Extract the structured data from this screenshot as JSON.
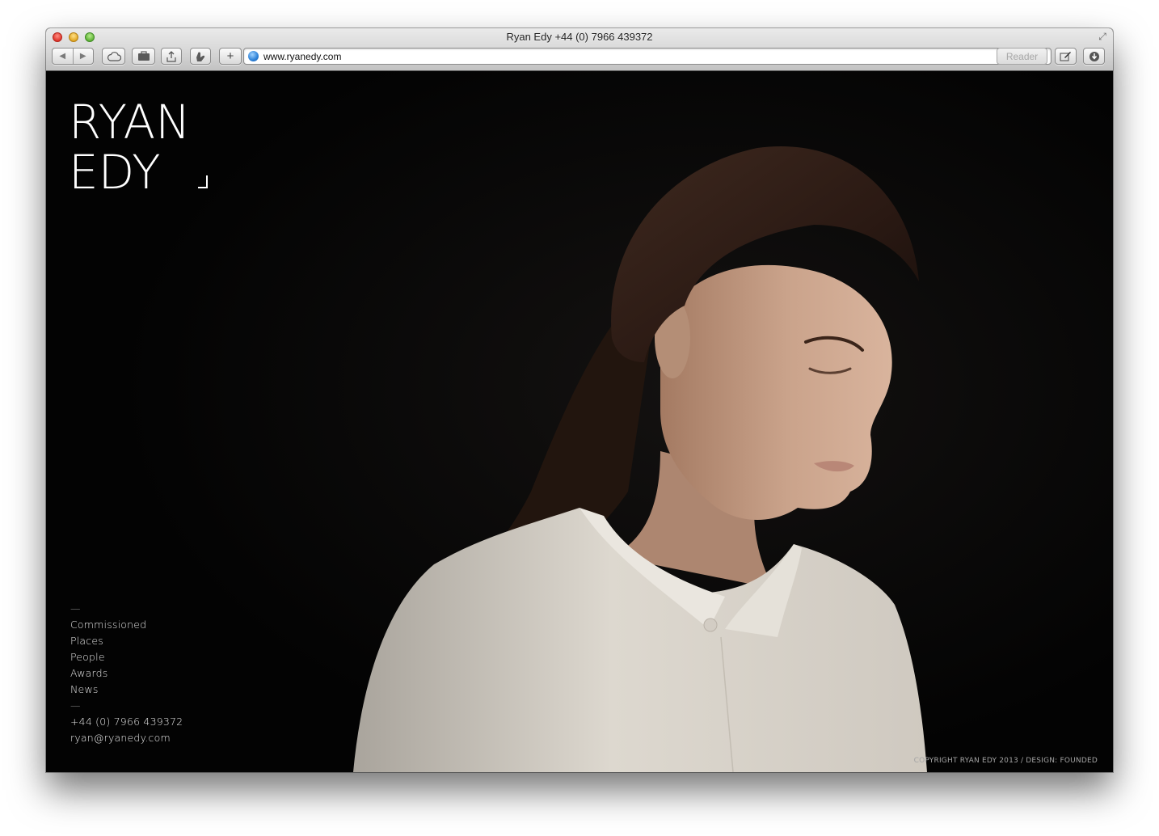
{
  "window": {
    "title": "Ryan Edy +44 (0) 7966 439372"
  },
  "toolbar": {
    "icons": [
      "back-icon",
      "forward-icon",
      "icloud-icon",
      "bookmarks-icon",
      "share-icon",
      "tabs-icon",
      "add-tab-icon",
      "globe-icon",
      "reload-icon",
      "edit-icon",
      "downloads-icon"
    ],
    "reader_label": "Reader"
  },
  "address_bar": {
    "url": "www.ryanedy.com"
  },
  "site": {
    "logo_line1": "RYAN",
    "logo_line2": "EDY",
    "nav_dash": "—",
    "nav_items": [
      "Commissioned",
      "Places",
      "People",
      "Awards",
      "News"
    ],
    "phone": "+44 (0) 7966 439372",
    "email": "ryan@ryanedy.com",
    "footer": "COPYRIGHT RYAN EDY 2013 / DESIGN: FOUNDED"
  },
  "colors": {
    "page_background": "#040404",
    "text_light": "#e6e6e6",
    "shirt": "#d8d2c9",
    "skin": "#c9a189",
    "hair": "#3a2419"
  }
}
